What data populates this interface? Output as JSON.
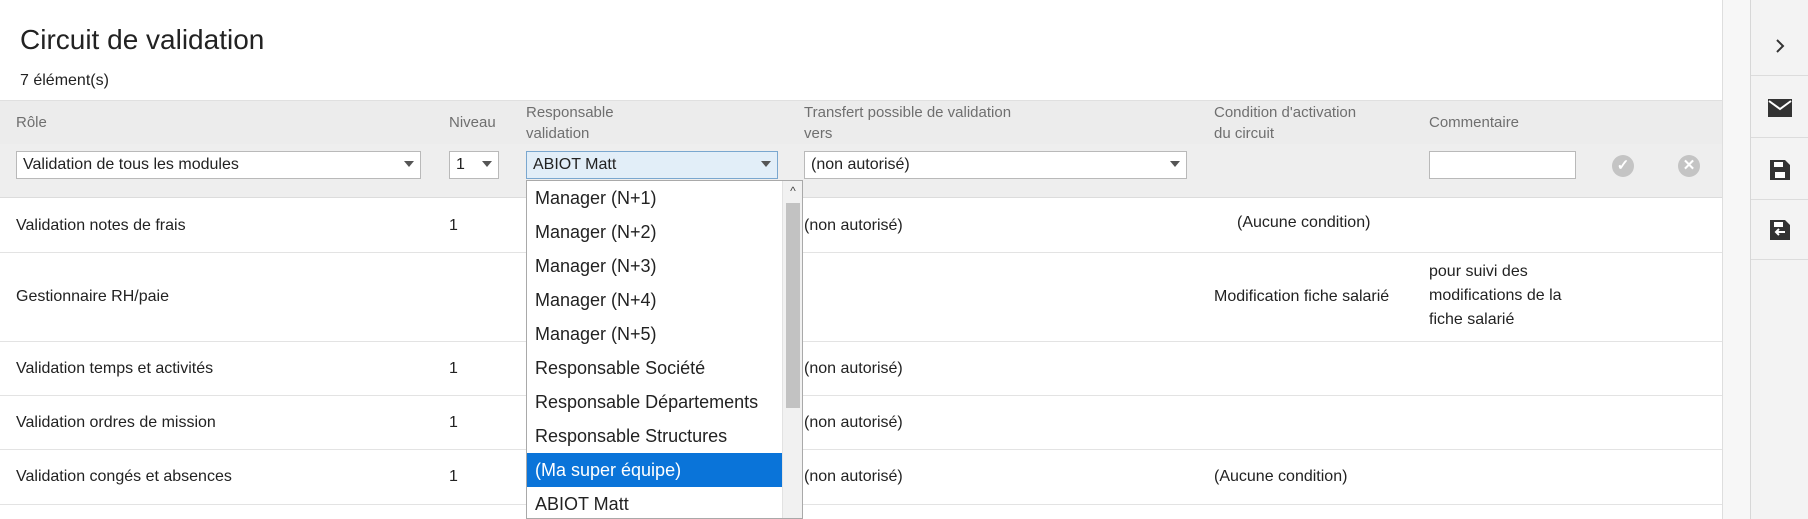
{
  "page": {
    "title": "Circuit de validation",
    "count": "7 élément(s)"
  },
  "columns": {
    "role": "Rôle",
    "niveau": "Niveau",
    "responsable_1": "Responsable",
    "responsable_2": "validation",
    "transfert_1": "Transfert possible de validation",
    "transfert_2": "vers",
    "condition_1": "Condition d'activation",
    "condition_2": "du circuit",
    "commentaire": "Commentaire"
  },
  "edit_row": {
    "role_value": "Validation de tous les modules",
    "niveau_value": "1",
    "responsable_value": "ABIOT Matt",
    "transfert_value": "(non autorisé)",
    "commentaire_value": ""
  },
  "rows": [
    {
      "role": "Validation notes de frais",
      "niveau": "1",
      "transfert": "(non autorisé)",
      "condition": "(Aucune condition)",
      "commentaire": ""
    },
    {
      "role": "Gestionnaire RH/paie",
      "niveau": "",
      "transfert": "",
      "condition": "Modification fiche salarié",
      "commentaire_1": "pour suivi des",
      "commentaire_2": "modifications de la",
      "commentaire_3": "fiche salarié"
    },
    {
      "role": "Validation temps et activités",
      "niveau": "1",
      "transfert": "(non autorisé)",
      "condition": "",
      "commentaire": ""
    },
    {
      "role": "Validation ordres de mission",
      "niveau": "1",
      "transfert": "(non autorisé)",
      "condition": "",
      "commentaire": ""
    },
    {
      "role": "Validation congés et absences",
      "niveau": "1",
      "transfert": "(non autorisé)",
      "condition": "(Aucune condition)",
      "commentaire": ""
    }
  ],
  "dropdown": {
    "options": [
      "Manager (N+1)",
      "Manager (N+2)",
      "Manager (N+3)",
      "Manager (N+4)",
      "Manager (N+5)",
      "Responsable Société",
      "Responsable Départements",
      "Responsable Structures",
      "(Ma super équipe)",
      "ABIOT Matt"
    ],
    "selected_option": "(Ma super équipe)",
    "selected_color": "#0a74d9"
  },
  "icons": {
    "validate_row": "validate-icon",
    "cancel_row": "cancel-icon",
    "sidebar": [
      "chevron-right-icon",
      "mail-icon",
      "save-icon",
      "save-as-icon"
    ]
  }
}
